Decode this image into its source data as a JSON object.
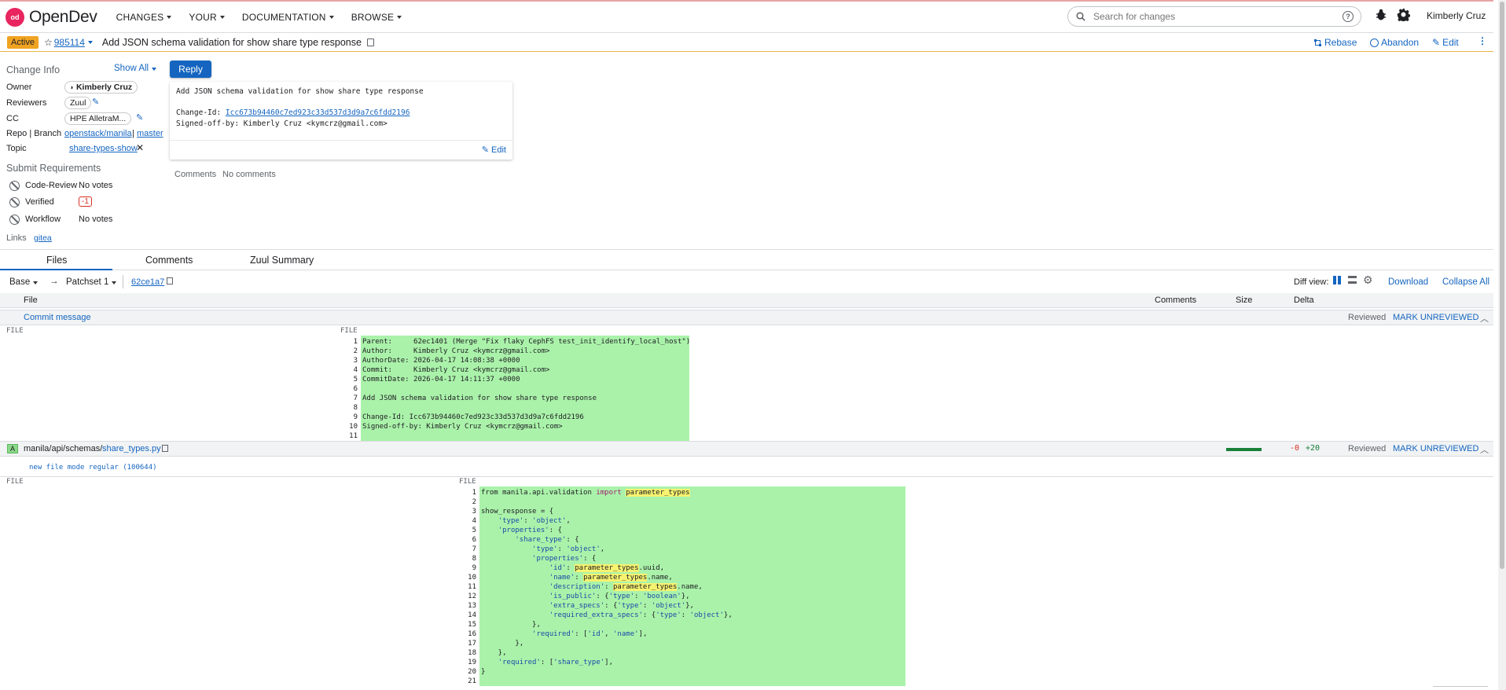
{
  "topbar": {
    "logo": "OpenDev",
    "nav": [
      "CHANGES",
      "YOUR",
      "DOCUMENTATION",
      "BROWSE"
    ],
    "search_placeholder": "Search for changes",
    "user": "Kimberly Cruz"
  },
  "change": {
    "status": "Active",
    "number": "985114",
    "subject": "Add JSON schema validation for show share type response",
    "actions": {
      "rebase": "Rebase",
      "abandon": "Abandon",
      "edit": "Edit"
    }
  },
  "info": {
    "title": "Change Info",
    "show_all": "Show All",
    "reply": "Reply",
    "owner_label": "Owner",
    "owner": "Kimberly Cruz",
    "reviewers_label": "Reviewers",
    "reviewer": "Zuul",
    "cc_label": "CC",
    "cc": "HPE AlletraM...",
    "repo_label": "Repo | Branch",
    "repo": "openstack/manila",
    "branch_sep": "|",
    "branch": "master",
    "topic_label": "Topic",
    "topic": "share-types-show"
  },
  "requirements": {
    "title": "Submit Requirements",
    "items": [
      {
        "name": "Code-Review",
        "value": "No votes"
      },
      {
        "name": "Verified",
        "value": "-1"
      },
      {
        "name": "Workflow",
        "value": "No votes"
      }
    ],
    "links_label": "Links",
    "link": "gitea"
  },
  "commit_box": {
    "line1": "Add JSON schema validation for show share type response",
    "changeid_label": "Change-Id: ",
    "changeid": "Icc673b94460c7ed923c33d537d3d9a7c6fdd2196",
    "signoff": "Signed-off-by: Kimberly Cruz <kymcrz@gmail.com>",
    "edit": "Edit"
  },
  "comments_row": {
    "label": "Comments",
    "value": "No comments"
  },
  "tabs": [
    "Files",
    "Comments",
    "Zuul Summary"
  ],
  "patchbar": {
    "base": "Base",
    "arrow": "→",
    "patchset": "Patchset 1",
    "commit": "62ce1a7",
    "diff_view": "Diff view:",
    "download": "Download",
    "collapse": "Collapse All"
  },
  "columns": {
    "file": "File",
    "comments": "Comments",
    "size": "Size",
    "delta": "Delta"
  },
  "commit_msg_row": {
    "name": "Commit message",
    "reviewed": "Reviewed",
    "mark": "MARK UNREVIEWED"
  },
  "file_row": {
    "status": "A",
    "path_prefix": "manila/api/schemas/",
    "path_file": "share_types.py",
    "minus": "-0",
    "plus": "+20",
    "reviewed": "Reviewed",
    "mark": "MARK UNREVIEWED",
    "mode": "new file mode regular (100644)"
  },
  "file_label": "FILE",
  "commit_diff": [
    "Parent:     62ec1401 (Merge \"Fix flaky CephFS test_init_identify_local_host\")",
    "Author:     Kimberly Cruz <kymcrz@gmail.com>",
    "AuthorDate: 2026-04-17 14:08:38 +0000",
    "Commit:     Kimberly Cruz <kymcrz@gmail.com>",
    "CommitDate: 2026-04-17 14:11:37 +0000",
    "",
    "Add JSON schema validation for show share type response",
    "",
    "Change-Id: Icc673b94460c7ed923c33d537d3d9a7c6fdd2196",
    "Signed-off-by: Kimberly Cruz <kymcrz@gmail.com>",
    ""
  ],
  "code_diff": [
    "from manila.api.validation import parameter_types",
    "",
    "show_response = {",
    "    'type': 'object',",
    "    'properties': {",
    "        'share_type': {",
    "            'type': 'object',",
    "            'properties': {",
    "                'id': parameter_types.uuid,",
    "                'name': parameter_types.name,",
    "                'description': parameter_types.name,",
    "                'is_public': {'type': 'boolean'},",
    "                'extra_specs': {'type': 'object'},",
    "                'required_extra_specs': {'type': 'object'},",
    "            },",
    "            'required': ['id', 'name'],",
    "        },",
    "    },",
    "    'required': ['share_type'],",
    "}",
    ""
  ]
}
